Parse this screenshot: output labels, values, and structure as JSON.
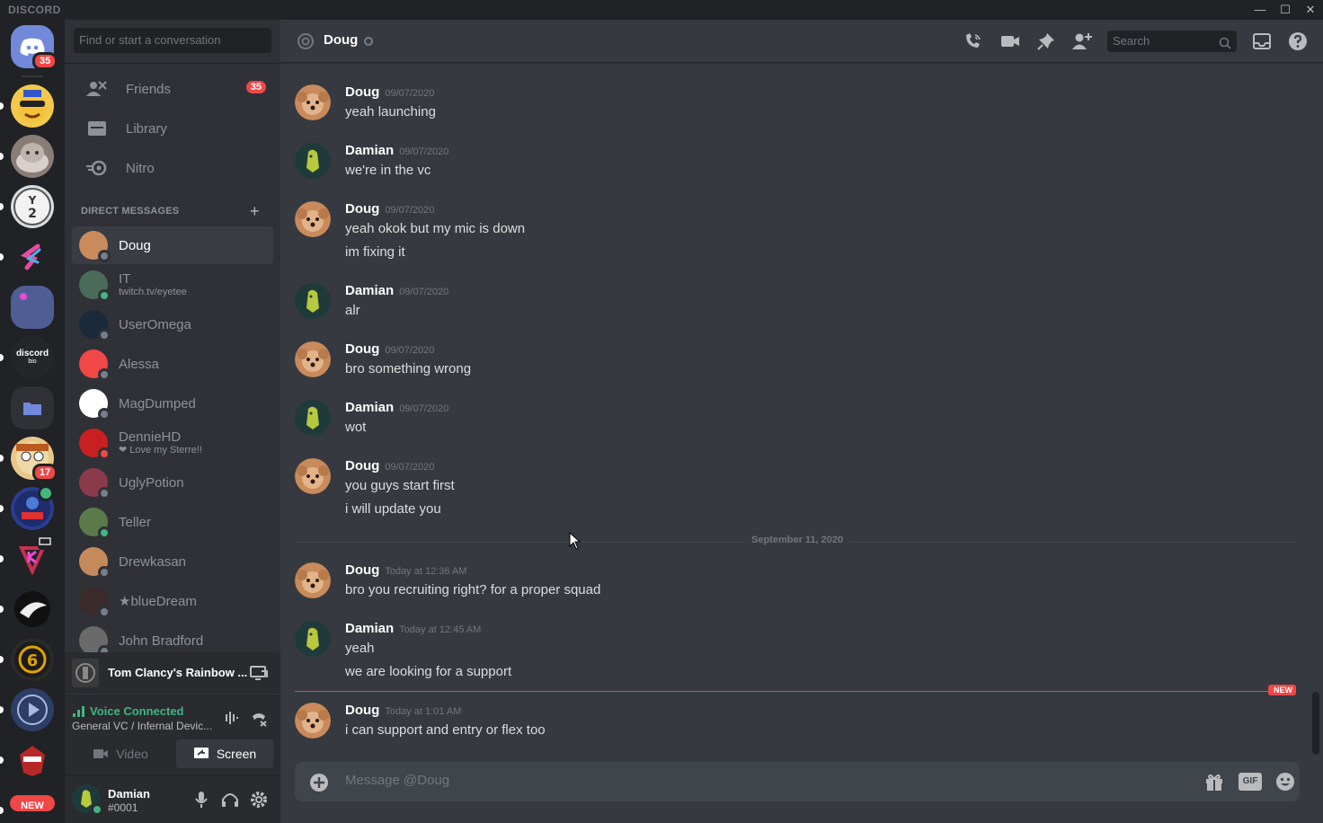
{
  "window": {
    "brand": "DISCORD"
  },
  "rail": {
    "home_badge": "35",
    "server_badge_17": "17",
    "new_label": "NEW",
    "bio_label": "discord",
    "bio_sub": "bio"
  },
  "sidebar": {
    "search_placeholder": "Find or start a conversation",
    "nav": [
      {
        "label": "Friends",
        "badge": "35"
      },
      {
        "label": "Library"
      },
      {
        "label": "Nitro"
      }
    ],
    "dm_header": "DIRECT MESSAGES",
    "dms": [
      {
        "name": "Doug",
        "status": "offline",
        "active": true
      },
      {
        "name": "IT",
        "sub": "twitch.tv/eyetee",
        "status": "online"
      },
      {
        "name": "UserOmega",
        "status": "offline"
      },
      {
        "name": "Alessa",
        "status": "offline"
      },
      {
        "name": "MagDumped",
        "status": "offline"
      },
      {
        "name": "DennieHD",
        "sub": "Love my Sterre!!",
        "status": "dnd"
      },
      {
        "name": "UglyPotion",
        "status": "offline"
      },
      {
        "name": "Teller",
        "status": "online"
      },
      {
        "name": "Drewkasan",
        "status": "offline"
      },
      {
        "name": "★blueDream",
        "status": "offline"
      },
      {
        "name": "John Bradford",
        "status": "offline"
      }
    ],
    "activity": {
      "game": "Tom Clancy's Rainbow ..."
    },
    "voice": {
      "status": "Voice Connected",
      "channel": "General VC / Infernal Devic...",
      "video_label": "Video",
      "screen_label": "Screen"
    },
    "user": {
      "name": "Damian",
      "tag": "#0001"
    }
  },
  "chat": {
    "recipient": "Doug",
    "search_placeholder": "Search",
    "date_divider": "September 11, 2020",
    "new_label": "NEW",
    "composer_placeholder": "Message @Doug",
    "gif_label": "GIF",
    "messages": [
      {
        "author": "Doug",
        "time": "09/07/2020",
        "lines": [
          "yeah launching"
        ]
      },
      {
        "author": "Damian",
        "time": "09/07/2020",
        "lines": [
          "we're in the vc"
        ]
      },
      {
        "author": "Doug",
        "time": "09/07/2020",
        "lines": [
          "yeah okok but my mic is down",
          "im fixing it"
        ]
      },
      {
        "author": "Damian",
        "time": "09/07/2020",
        "lines": [
          "alr"
        ]
      },
      {
        "author": "Doug",
        "time": "09/07/2020",
        "lines": [
          "bro something wrong"
        ]
      },
      {
        "author": "Damian",
        "time": "09/07/2020",
        "lines": [
          "wot"
        ]
      },
      {
        "author": "Doug",
        "time": "09/07/2020",
        "lines": [
          "you guys start first",
          "i will update you"
        ]
      },
      {
        "author": "Doug",
        "time": "Today at 12:36 AM",
        "lines": [
          "bro you recruiting right? for a proper squad"
        ]
      },
      {
        "author": "Damian",
        "time": "Today at 12:45 AM",
        "lines": [
          "yeah",
          "we are looking for a support"
        ]
      },
      {
        "author": "Doug",
        "time": "Today at 1:01 AM",
        "lines": [
          "i can support and entry or flex too"
        ]
      }
    ]
  },
  "colors": {
    "blurple": "#7289da",
    "online": "#43b581",
    "dnd": "#f04747",
    "offline": "#747f8d",
    "voice_green": "#43b581"
  }
}
